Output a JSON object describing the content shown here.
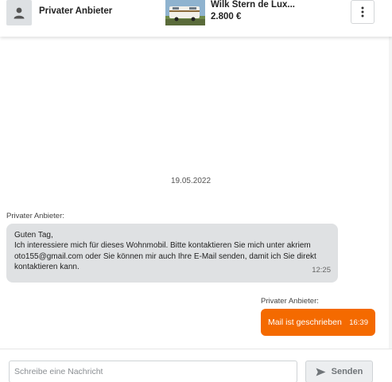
{
  "header": {
    "seller_name": "Privater Anbieter",
    "listing_title": "Wilk Stern de Lux...",
    "listing_price": "2.800 €",
    "avatar_icon": "user-icon",
    "menu_icon": "more-vertical-icon"
  },
  "chat": {
    "date_separator": "19.05.2022",
    "messages": [
      {
        "direction": "incoming",
        "sender": "Privater Anbieter:",
        "lines": [
          "Guten Tag,",
          " Ich interessiere mich für dieses Wohnmobil.  Bitte kontaktieren Sie mich unter akriem",
          "oto155@gmail.com oder Sie können mir auch Ihre E-Mail senden, damit ich Sie direkt",
          "kontaktieren kann."
        ],
        "time": "12:25"
      },
      {
        "direction": "outgoing",
        "sender": "Privater Anbieter:",
        "text": "Mail ist geschrieben",
        "time": "16:39"
      }
    ]
  },
  "composer": {
    "placeholder": "Schreibe eine Nachricht",
    "value": "",
    "send_label": "Senden",
    "send_icon": "send-icon"
  },
  "colors": {
    "accent": "#f46a00",
    "incoming_bubble": "#dfe1e3",
    "avatar_bg": "#dde0e3"
  }
}
